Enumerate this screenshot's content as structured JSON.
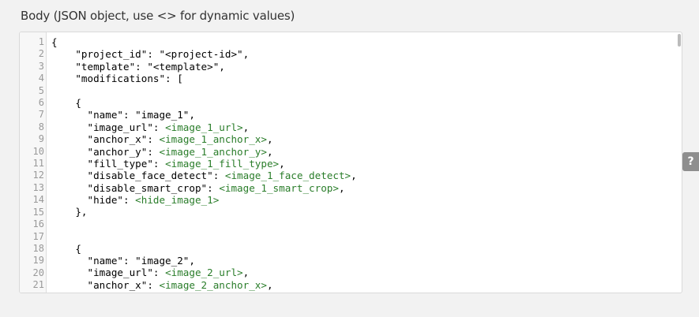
{
  "body_field": {
    "label": "Body (JSON object, use <> for dynamic values)"
  },
  "editor": {
    "line_numbers": [
      "1",
      "2",
      "3",
      "4",
      "5",
      "6",
      "7",
      "8",
      "9",
      "10",
      "11",
      "12",
      "13",
      "14",
      "15",
      "16",
      "17",
      "18",
      "19",
      "20",
      "21"
    ],
    "lines": [
      [
        {
          "t": "{",
          "c": "str"
        }
      ],
      [
        {
          "t": "    \"project_id\": \"<project-id>\",",
          "c": "str"
        }
      ],
      [
        {
          "t": "    \"template\": \"<template>\",",
          "c": "str"
        }
      ],
      [
        {
          "t": "    \"modifications\": [",
          "c": "str"
        }
      ],
      [
        {
          "t": "",
          "c": "str"
        }
      ],
      [
        {
          "t": "    {",
          "c": "str"
        }
      ],
      [
        {
          "t": "      \"name\": \"image_1\",",
          "c": "str"
        }
      ],
      [
        {
          "t": "      \"image_url\": ",
          "c": "str"
        },
        {
          "t": "<image_1_url>",
          "c": "dyn"
        },
        {
          "t": ",",
          "c": "str"
        }
      ],
      [
        {
          "t": "      \"anchor_x\": ",
          "c": "str"
        },
        {
          "t": "<image_1_anchor_x>",
          "c": "dyn"
        },
        {
          "t": ",",
          "c": "str"
        }
      ],
      [
        {
          "t": "      \"anchor_y\": ",
          "c": "str"
        },
        {
          "t": "<image_1_anchor_y>",
          "c": "dyn"
        },
        {
          "t": ",",
          "c": "str"
        }
      ],
      [
        {
          "t": "      \"fill_type\": ",
          "c": "str"
        },
        {
          "t": "<image_1_fill_type>",
          "c": "dyn"
        },
        {
          "t": ",",
          "c": "str"
        }
      ],
      [
        {
          "t": "      \"disable_face_detect\": ",
          "c": "str"
        },
        {
          "t": "<image_1_face_detect>",
          "c": "dyn"
        },
        {
          "t": ",",
          "c": "str"
        }
      ],
      [
        {
          "t": "      \"disable_smart_crop\": ",
          "c": "str"
        },
        {
          "t": "<image_1_smart_crop>",
          "c": "dyn"
        },
        {
          "t": ",",
          "c": "str"
        }
      ],
      [
        {
          "t": "      \"hide\": ",
          "c": "str"
        },
        {
          "t": "<hide_image_1>",
          "c": "dyn"
        }
      ],
      [
        {
          "t": "    },",
          "c": "str"
        }
      ],
      [
        {
          "t": "",
          "c": "str"
        }
      ],
      [
        {
          "t": "",
          "c": "str"
        }
      ],
      [
        {
          "t": "    {",
          "c": "str"
        }
      ],
      [
        {
          "t": "      \"name\": \"image_2\",",
          "c": "str"
        }
      ],
      [
        {
          "t": "      \"image_url\": ",
          "c": "str"
        },
        {
          "t": "<image_2_url>",
          "c": "dyn"
        },
        {
          "t": ",",
          "c": "str"
        }
      ],
      [
        {
          "t": "      \"anchor_x\": ",
          "c": "str"
        },
        {
          "t": "<image_2_anchor_x>",
          "c": "dyn"
        },
        {
          "t": ",",
          "c": "str"
        }
      ]
    ]
  },
  "help_button": {
    "label": "?"
  },
  "colors": {
    "dynamic_value": "#2a7d2a",
    "help_button_bg": "#8e8e8e"
  }
}
